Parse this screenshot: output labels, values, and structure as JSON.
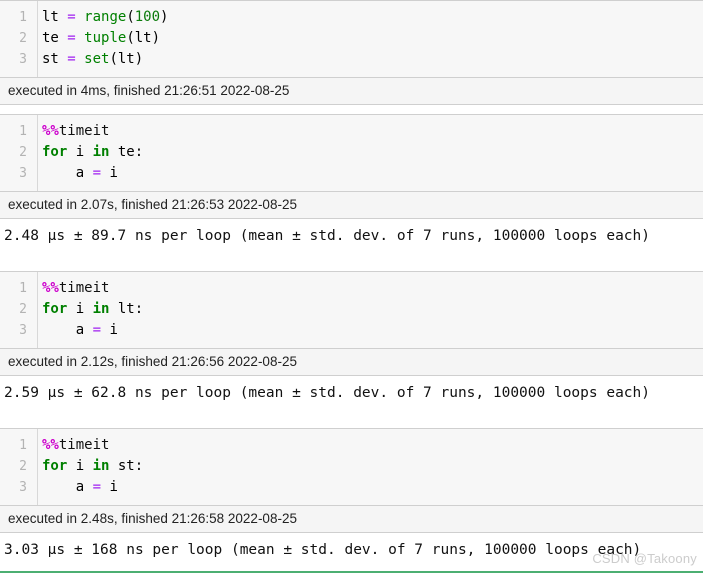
{
  "notebook": {
    "cells": [
      {
        "id": "cell-1",
        "code_lines": [
          {
            "number": "1",
            "tokens": [
              {
                "t": "lt ",
                "c": "tok-name"
              },
              {
                "t": "= ",
                "c": "tok-op"
              },
              {
                "t": "range",
                "c": "tok-builtin"
              },
              {
                "t": "(",
                "c": "tok-punct"
              },
              {
                "t": "100",
                "c": "tok-num"
              },
              {
                "t": ")",
                "c": "tok-punct"
              }
            ]
          },
          {
            "number": "2",
            "tokens": [
              {
                "t": "te ",
                "c": "tok-name"
              },
              {
                "t": "= ",
                "c": "tok-op"
              },
              {
                "t": "tuple",
                "c": "tok-builtin"
              },
              {
                "t": "(lt)",
                "c": "tok-punct"
              }
            ]
          },
          {
            "number": "3",
            "tokens": [
              {
                "t": "st ",
                "c": "tok-name"
              },
              {
                "t": "= ",
                "c": "tok-op"
              },
              {
                "t": "set",
                "c": "tok-builtin"
              },
              {
                "t": "(lt)",
                "c": "tok-punct"
              }
            ]
          }
        ],
        "executed": "executed in 4ms, finished 21:26:51 2022-08-25",
        "output": null
      },
      {
        "id": "cell-2",
        "code_lines": [
          {
            "number": "1",
            "tokens": [
              {
                "t": "%%",
                "c": "tok-magic"
              },
              {
                "t": "timeit",
                "c": "tok-plain"
              }
            ]
          },
          {
            "number": "2",
            "tokens": [
              {
                "t": "for",
                "c": "tok-kw"
              },
              {
                "t": " i ",
                "c": "tok-name"
              },
              {
                "t": "in",
                "c": "tok-kw"
              },
              {
                "t": " te:",
                "c": "tok-name"
              }
            ]
          },
          {
            "number": "3",
            "tokens": [
              {
                "t": "    a ",
                "c": "tok-name"
              },
              {
                "t": "= ",
                "c": "tok-op"
              },
              {
                "t": "i",
                "c": "tok-name"
              }
            ]
          }
        ],
        "executed": "executed in 2.07s, finished 21:26:53 2022-08-25",
        "output": "2.48 µs ± 89.7 ns per loop (mean ± std. dev. of 7 runs, 100000 loops each)"
      },
      {
        "id": "cell-3",
        "code_lines": [
          {
            "number": "1",
            "tokens": [
              {
                "t": "%%",
                "c": "tok-magic"
              },
              {
                "t": "timeit",
                "c": "tok-plain"
              }
            ]
          },
          {
            "number": "2",
            "tokens": [
              {
                "t": "for",
                "c": "tok-kw"
              },
              {
                "t": " i ",
                "c": "tok-name"
              },
              {
                "t": "in",
                "c": "tok-kw"
              },
              {
                "t": " lt:",
                "c": "tok-name"
              }
            ]
          },
          {
            "number": "3",
            "tokens": [
              {
                "t": "    a ",
                "c": "tok-name"
              },
              {
                "t": "= ",
                "c": "tok-op"
              },
              {
                "t": "i",
                "c": "tok-name"
              }
            ]
          }
        ],
        "executed": "executed in 2.12s, finished 21:26:56 2022-08-25",
        "output": "2.59 µs ± 62.8 ns per loop (mean ± std. dev. of 7 runs, 100000 loops each)"
      },
      {
        "id": "cell-4",
        "code_lines": [
          {
            "number": "1",
            "tokens": [
              {
                "t": "%%",
                "c": "tok-magic"
              },
              {
                "t": "timeit",
                "c": "tok-plain"
              }
            ]
          },
          {
            "number": "2",
            "tokens": [
              {
                "t": "for",
                "c": "tok-kw"
              },
              {
                "t": " i ",
                "c": "tok-name"
              },
              {
                "t": "in",
                "c": "tok-kw"
              },
              {
                "t": " st:",
                "c": "tok-name"
              }
            ]
          },
          {
            "number": "3",
            "tokens": [
              {
                "t": "    a ",
                "c": "tok-name"
              },
              {
                "t": "= ",
                "c": "tok-op"
              },
              {
                "t": "i",
                "c": "tok-name"
              }
            ]
          }
        ],
        "executed": "executed in 2.48s, finished 21:26:58 2022-08-25",
        "output": "3.03 µs ± 168 ns per loop (mean ± std. dev. of 7 runs, 100000 loops each)"
      }
    ]
  },
  "watermark": {
    "text": "CSDN @Takoony",
    "color": "#cccccc"
  },
  "colors": {
    "code_background": "#f7f7f7",
    "exec_background": "#f5f5f5",
    "border": "#cfcfcf",
    "gutter_text": "#b3b3b3",
    "keyword_green": "#008000",
    "magic_magenta": "#cc00cc",
    "operator_purple": "#a020f0",
    "bottom_rule": "#4caf72"
  }
}
